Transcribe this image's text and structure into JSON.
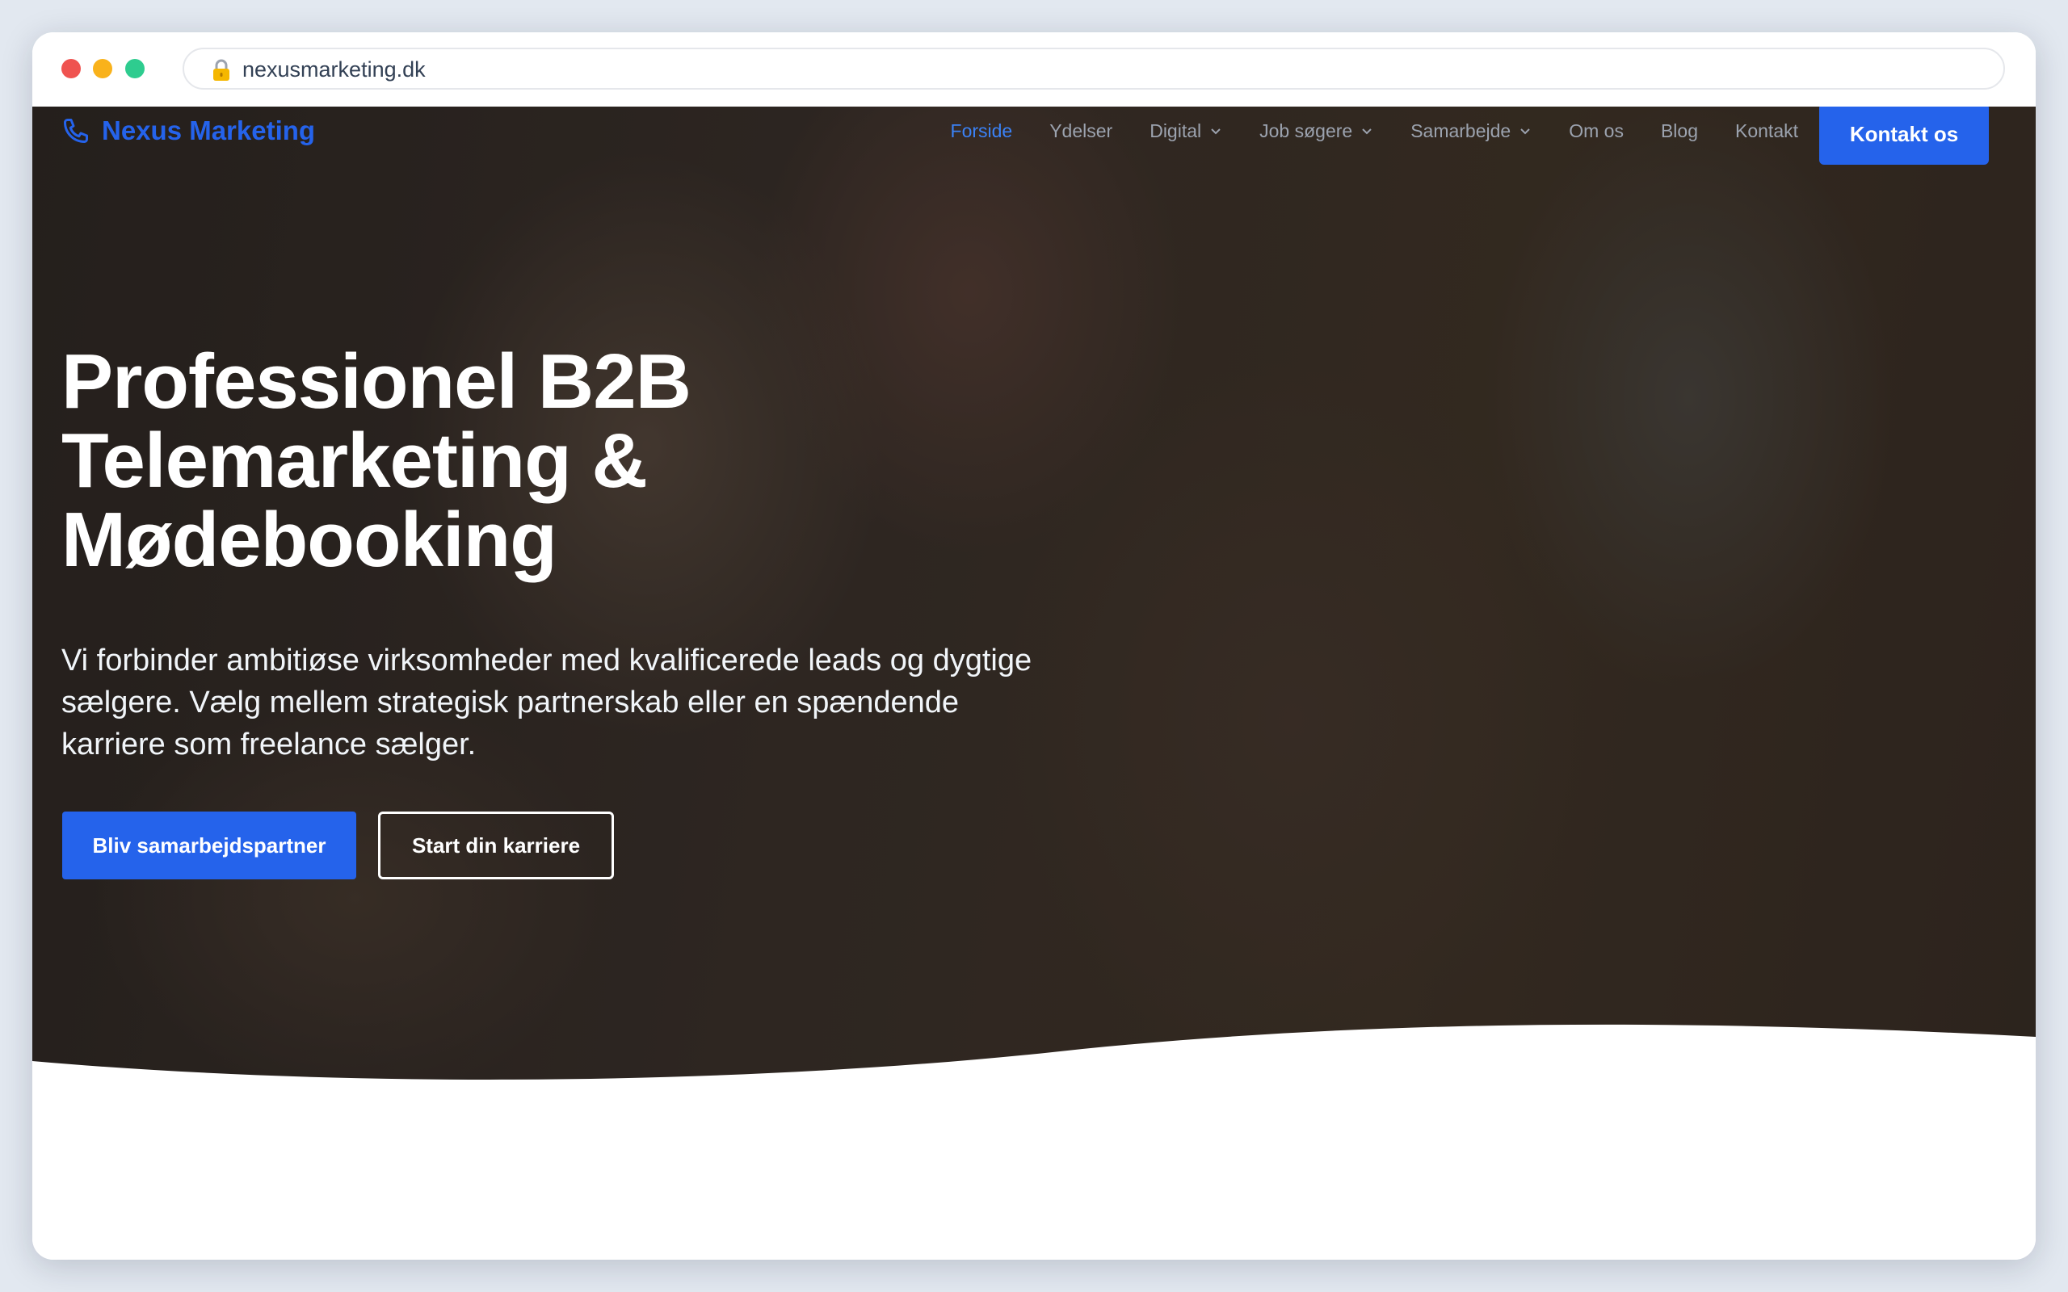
{
  "browser": {
    "url": "nexusmarketing.dk",
    "lock_icon": "lock-icon"
  },
  "site": {
    "brand": "Nexus Marketing",
    "brand_icon": "phone-icon",
    "accent_color": "#2563eb"
  },
  "nav": {
    "items": [
      {
        "label": "Forside",
        "active": true
      },
      {
        "label": "Ydelser"
      },
      {
        "label": "Digital",
        "dropdown": true
      },
      {
        "label": "Job søgere",
        "dropdown": true
      },
      {
        "label": "Samarbejde",
        "dropdown": true
      },
      {
        "label": "Om os"
      },
      {
        "label": "Blog"
      },
      {
        "label": "Kontakt"
      }
    ],
    "cta": "Kontakt os"
  },
  "hero": {
    "title": "Professionel B2B Telemarketing & Mødebooking",
    "subtitle": "Vi forbinder ambitiøse virksomheder med kvalificerede leads og dygtige sælgere. Vælg mellem strategisk partnerskab eller en spændende karriere som freelance sælger.",
    "primary_button": "Bliv samarbejdspartner",
    "secondary_button": "Start din karriere"
  }
}
